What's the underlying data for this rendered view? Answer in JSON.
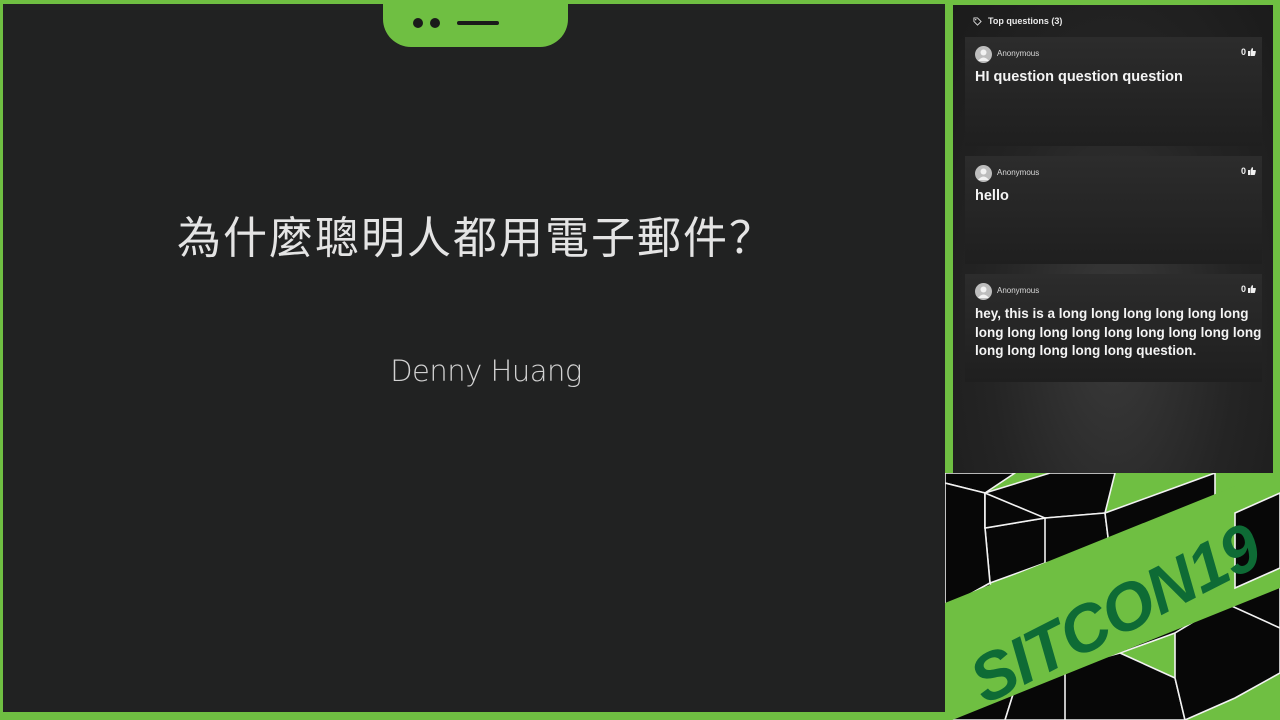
{
  "slide": {
    "title": "為什麼聰明人都用電子郵件？",
    "subtitle": "Denny Huang"
  },
  "panel": {
    "header": "Top questions (3)",
    "questions": [
      {
        "author": "Anonymous",
        "votes": "0",
        "text": "HI question question question"
      },
      {
        "author": "Anonymous",
        "votes": "0",
        "text": "hello"
      },
      {
        "author": "Anonymous",
        "votes": "0",
        "text": "hey, this is a long long long long long long long long long long long long long long long long long long long long question."
      }
    ]
  },
  "branding": {
    "logo_text": "SITCON19"
  },
  "colors": {
    "accent_green": "#6fbf42",
    "slide_bg": "#212222",
    "logo_green": "#0e6b35"
  }
}
